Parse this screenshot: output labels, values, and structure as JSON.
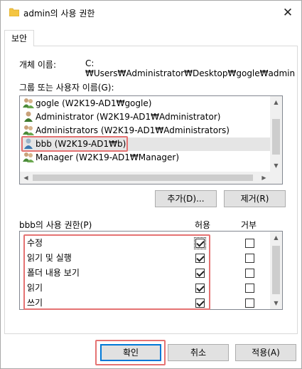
{
  "window": {
    "title": "admin의 사용 권한",
    "close_glyph": "✕",
    "icon": "folder-icon"
  },
  "tabs": [
    {
      "label": "보안",
      "selected": true
    }
  ],
  "object_name": {
    "label": "개체 이름:",
    "value": "C:₩Users₩Administrator₩Desktop₩gogle₩admin"
  },
  "groups": {
    "label": "그룹 또는 사용자 이름(G):",
    "items": [
      {
        "name": "gogle (W2K19-AD1₩gogle)",
        "icon": "group-users-icon"
      },
      {
        "name": "Administrator (W2K19-AD1₩Administrator)",
        "icon": "user-icon"
      },
      {
        "name": "Administrators (W2K19-AD1₩Administrators)",
        "icon": "group-users-icon"
      },
      {
        "name": "bbb (W2K19-AD1₩b)",
        "icon": "user-icon",
        "selected": true
      },
      {
        "name": "Manager (W2K19-AD1₩Manager)",
        "icon": "group-users-icon"
      }
    ],
    "add_button": "추가(D)...",
    "remove_button": "제거(R)"
  },
  "permissions": {
    "label": "bbb의 사용 권한(P)",
    "allow_header": "허용",
    "deny_header": "거부",
    "rows": [
      {
        "name": "수정",
        "allow": true,
        "deny": false
      },
      {
        "name": "읽기 및 실행",
        "allow": true,
        "deny": false
      },
      {
        "name": "폴더 내용 보기",
        "allow": true,
        "deny": false
      },
      {
        "name": "읽기",
        "allow": true,
        "deny": false
      },
      {
        "name": "쓰기",
        "allow": true,
        "deny": false
      }
    ]
  },
  "footer": {
    "ok": "확인",
    "cancel": "취소",
    "apply": "적용(A)"
  },
  "colors": {
    "highlight_border": "#e57373",
    "focus_blue": "#0078d7",
    "selection_bg": "#e5e5e5",
    "folder_yellow": "#f4c542"
  }
}
